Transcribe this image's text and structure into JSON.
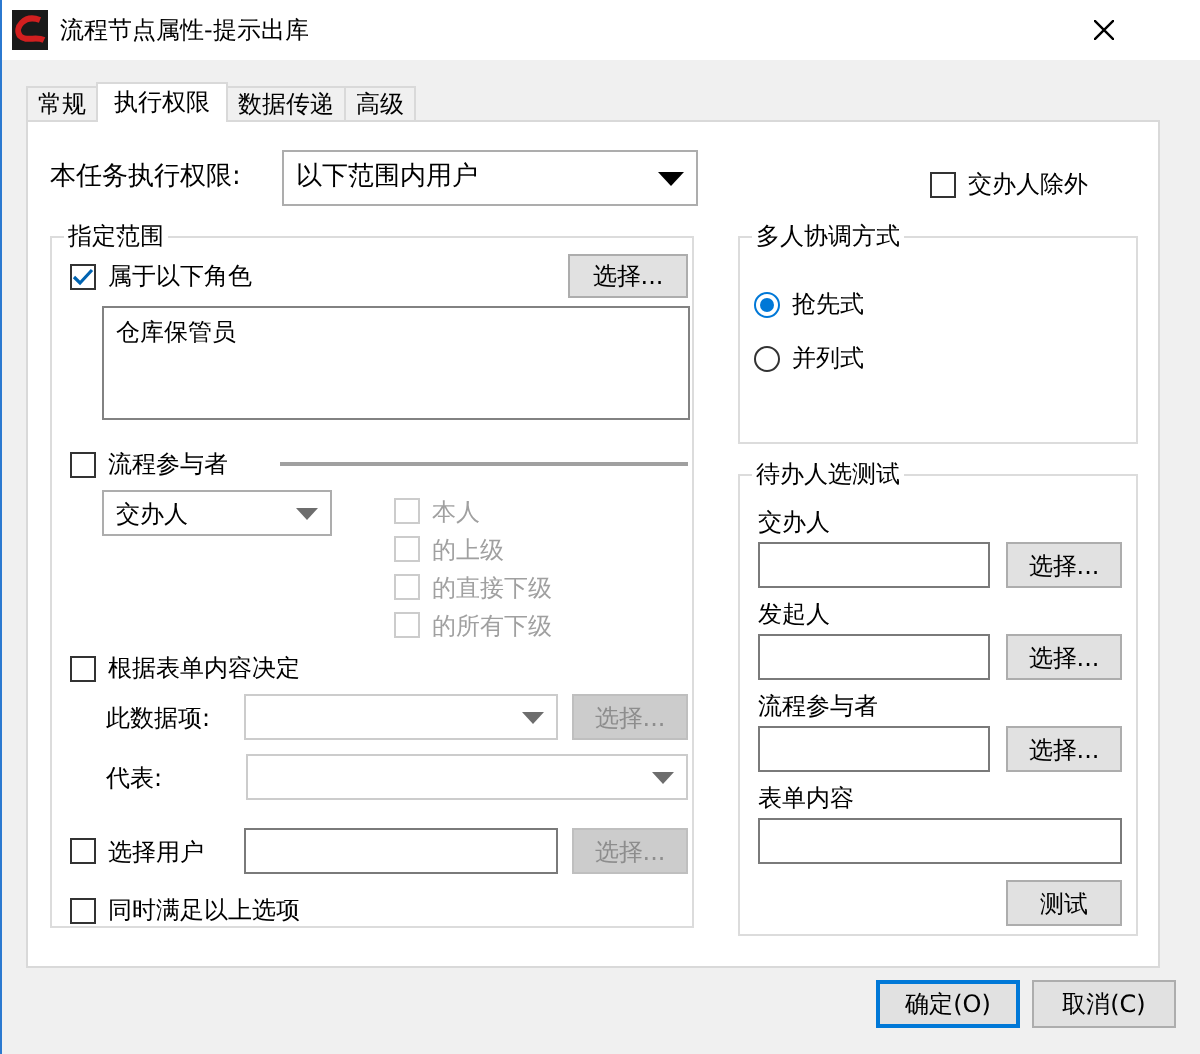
{
  "window": {
    "title": "流程节点属性-提示出库"
  },
  "tabs": [
    {
      "label": "常规",
      "selected": false
    },
    {
      "label": "执行权限",
      "selected": true
    },
    {
      "label": "数据传递",
      "selected": false
    },
    {
      "label": "高级",
      "selected": false
    }
  ],
  "permission": {
    "label": "本任务执行权限:",
    "value": "以下范围内用户"
  },
  "exclude_assignee": {
    "label": "交办人除外",
    "checked": false
  },
  "scope": {
    "title": "指定范围",
    "roles": {
      "label": "属于以下角色",
      "checked": true,
      "button": "选择...",
      "list": [
        "仓库保管员"
      ]
    },
    "participants": {
      "label": "流程参与者",
      "checked": false,
      "value": "交办人",
      "options": [
        {
          "label": "本人",
          "checked": false,
          "disabled": true
        },
        {
          "label": "的上级",
          "checked": false,
          "disabled": true
        },
        {
          "label": "的直接下级",
          "checked": false,
          "disabled": true
        },
        {
          "label": "的所有下级",
          "checked": false,
          "disabled": true
        }
      ]
    },
    "form_content": {
      "label": "根据表单内容决定",
      "checked": false,
      "data_item_label": "此数据项:",
      "data_item_button": {
        "label": "选择...",
        "disabled": true
      },
      "represents_label": "代表:"
    },
    "select_user": {
      "label": "选择用户",
      "checked": false,
      "button": {
        "label": "选择...",
        "disabled": true
      }
    },
    "all_conditions": {
      "label": "同时满足以上选项",
      "checked": false
    }
  },
  "coordination": {
    "title": "多人协调方式",
    "options": [
      {
        "label": "抢先式",
        "selected": true
      },
      {
        "label": "并列式",
        "selected": false
      }
    ]
  },
  "test": {
    "title": "待办人选测试",
    "fields": [
      {
        "label": "交办人",
        "button": "选择..."
      },
      {
        "label": "发起人",
        "button": "选择..."
      },
      {
        "label": "流程参与者",
        "button": "选择..."
      },
      {
        "label": "表单内容"
      }
    ],
    "button": "测试"
  },
  "buttons": [
    {
      "label": "确定(O)",
      "default": true
    },
    {
      "label": "取消(C)",
      "default": false
    }
  ]
}
